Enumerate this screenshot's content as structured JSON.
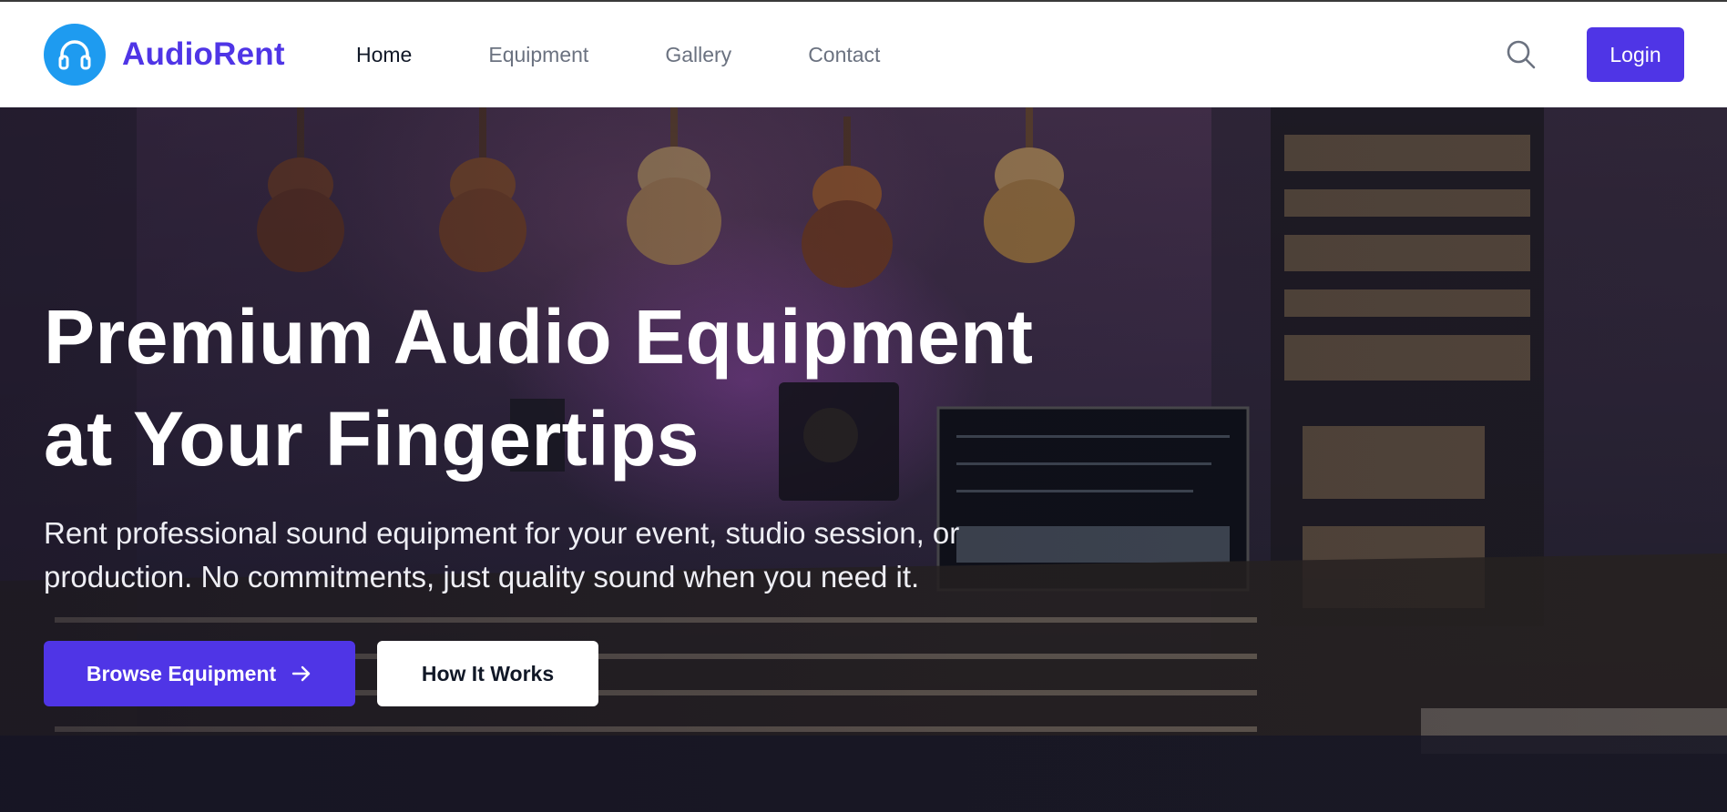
{
  "brand": {
    "name": "AudioRent",
    "icon": "headphones-icon",
    "color": "#4f35e6",
    "badge_color": "#1e9bf0"
  },
  "nav": {
    "links": [
      {
        "label": "Home",
        "active": true
      },
      {
        "label": "Equipment",
        "active": false
      },
      {
        "label": "Gallery",
        "active": false
      },
      {
        "label": "Contact",
        "active": false
      }
    ],
    "search_icon": "search-icon",
    "login_label": "Login"
  },
  "hero": {
    "title_line1": "Premium Audio Equipment",
    "title_line2": "at Your Fingertips",
    "subtitle_line1": "Rent professional sound equipment for your event, studio session, or",
    "subtitle_line2": "production. No commitments, just quality sound when you need it.",
    "primary_button": "Browse Equipment",
    "primary_button_icon": "arrow-right-icon",
    "secondary_button": "How It Works",
    "background_image": "recording-studio-photo"
  },
  "colors": {
    "accent": "#4f35e6",
    "nav_text": "#6b7280",
    "nav_active": "#111827"
  }
}
